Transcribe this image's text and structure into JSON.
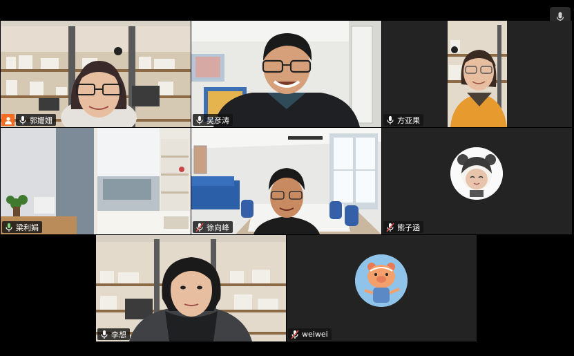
{
  "participants": [
    {
      "name": "郭姗姗",
      "mic": "on",
      "host": true
    },
    {
      "name": "吴彦涛",
      "mic": "on"
    },
    {
      "name": "方亚果",
      "mic": "on"
    },
    {
      "name": "梁利娟",
      "mic": "on"
    },
    {
      "name": "徐向峰",
      "mic": "muted"
    },
    {
      "name": "熊子涵",
      "mic": "muted"
    },
    {
      "name": "李想",
      "mic": "on"
    },
    {
      "name": "weiwei",
      "mic": "muted"
    }
  ],
  "colors": {
    "accent_active": "#2ecc40",
    "host_badge": "#f26d21",
    "mic_on": "#ffffff",
    "mic_muted": "#e0524a",
    "tile_bg": "#232323"
  }
}
